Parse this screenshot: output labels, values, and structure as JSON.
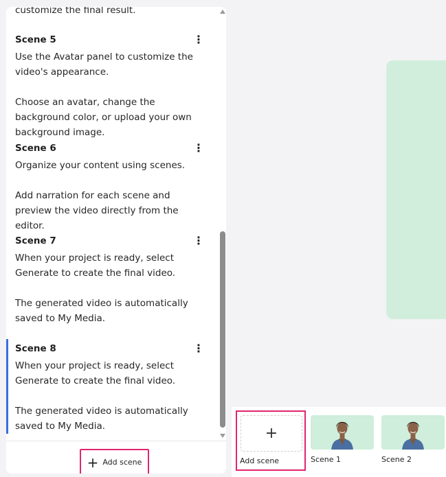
{
  "script_panel": {
    "top_fragment": "customize the final result.",
    "scenes": [
      {
        "title": "Scene 5",
        "paragraphs": [
          "Use the Avatar panel to customize the video's appearance.",
          "Choose an avatar, change the background color, or upload your own background image."
        ]
      },
      {
        "title": "Scene 6",
        "paragraphs": [
          "Organize your content using scenes.",
          "Add narration for each scene and preview the video directly from the editor."
        ]
      },
      {
        "title": "Scene 7",
        "paragraphs": [
          "When your project is ready, select Generate to create the final video.",
          "The generated video is automatically saved to My Media."
        ]
      },
      {
        "title": "Scene 8",
        "paragraphs": [
          "When your project is ready, select Generate to create the final video.",
          "The generated video is automatically saved to My Media."
        ]
      }
    ],
    "add_scene_label": "Add scene",
    "add_icon": "plus-icon",
    "menu_icon": "kebab-menu-icon"
  },
  "timeline": {
    "add_scene_label": "Add scene",
    "add_symbol": "+",
    "thumbnails": [
      {
        "label": "Scene 1"
      },
      {
        "label": "Scene 2"
      }
    ]
  },
  "colors": {
    "highlight": "#e0246f",
    "active_scene": "#3a6fdc",
    "canvas_bg": "#d1eedc"
  }
}
